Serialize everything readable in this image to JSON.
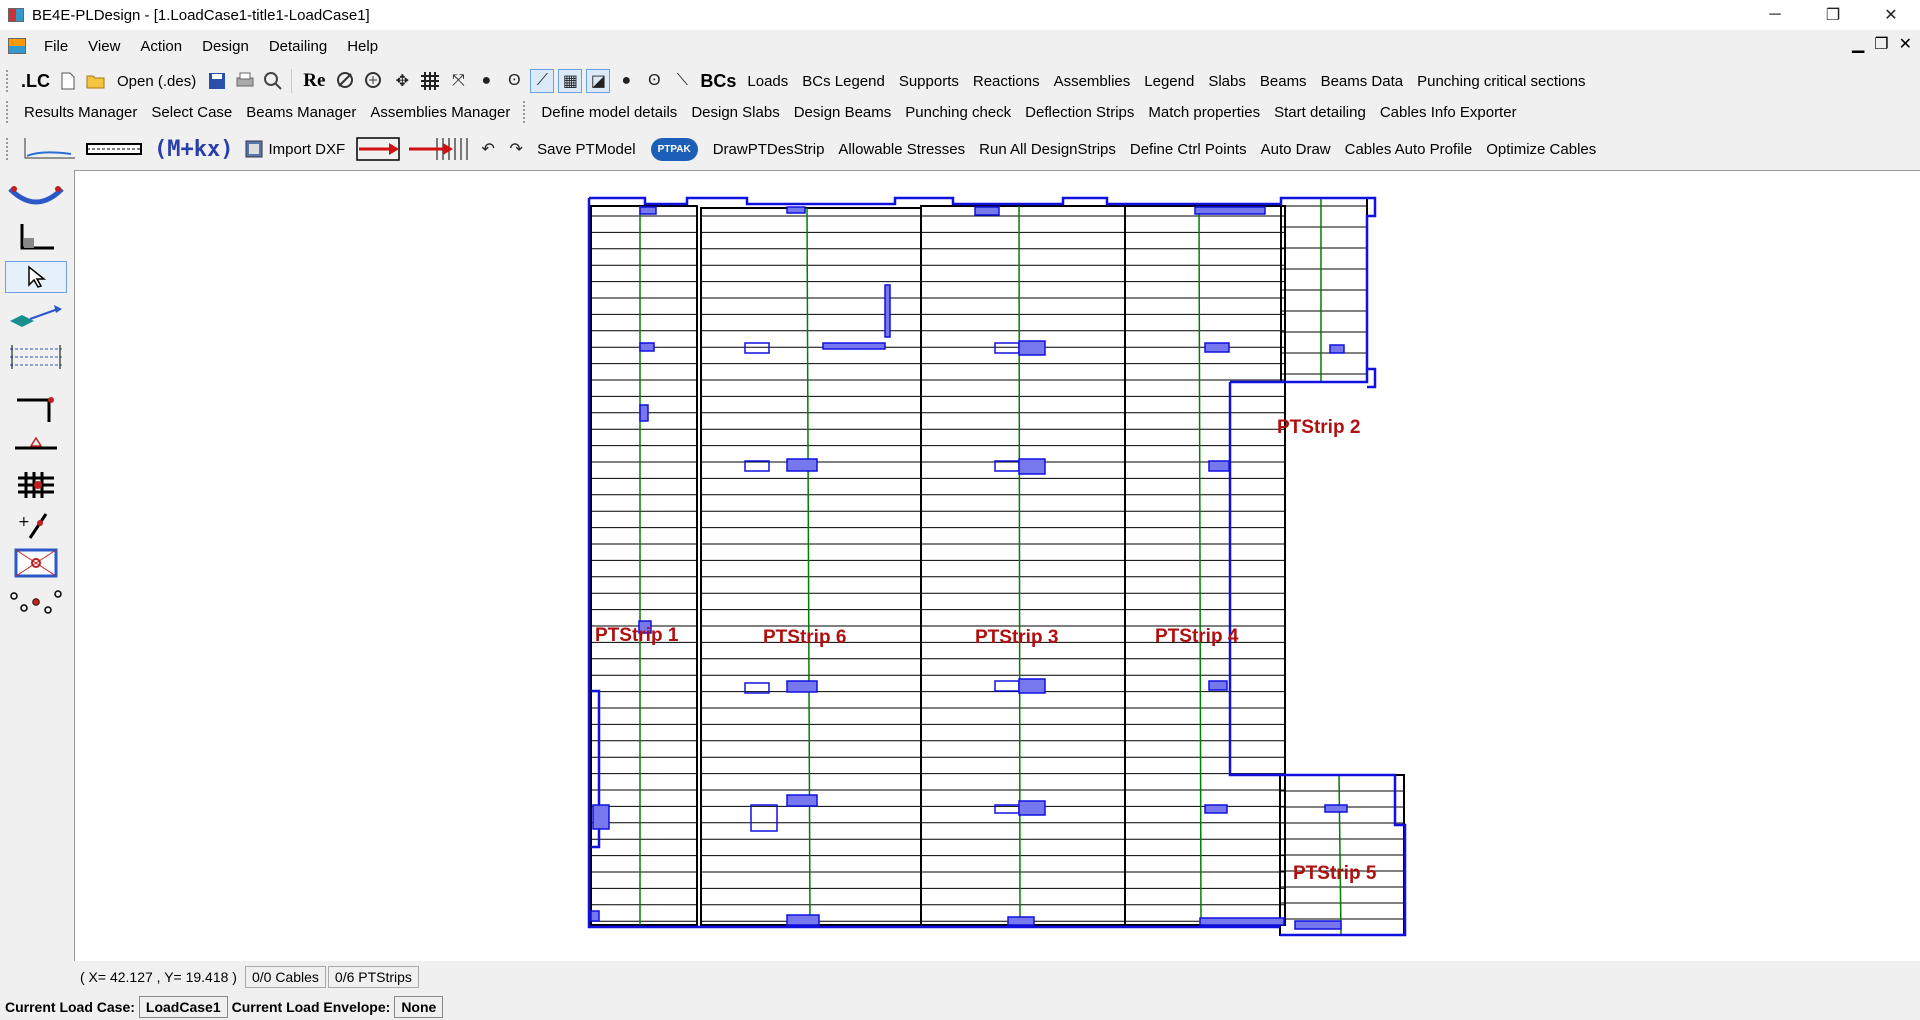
{
  "window": {
    "title": "BE4E-PLDesign - [1.LoadCase1-title1-LoadCase1]",
    "controls": {
      "minimize": "─",
      "restore": "❐",
      "close": "✕"
    }
  },
  "menu": {
    "items": [
      "File",
      "View",
      "Action",
      "Design",
      "Detailing",
      "Help"
    ],
    "mdi_controls": {
      "minimize": "▁",
      "restore": "❐",
      "close": "✕"
    }
  },
  "toolbar1": {
    "lc": ".LC",
    "open": "Open (.des)",
    "re": "Re",
    "bcs": "BCs",
    "buttons": [
      "Loads",
      "BCs Legend",
      "Supports",
      "Reactions",
      "Assemblies",
      "Legend",
      "Slabs",
      "Beams",
      "Beams Data",
      "Punching critical sections"
    ]
  },
  "toolbar2": {
    "buttons_a": [
      "Results Manager",
      "Select Case",
      "Beams Manager",
      "Assemblies Manager"
    ],
    "buttons_b": [
      "Define model details",
      "Design Slabs",
      "Design Beams",
      "Punching check",
      "Deflection Strips",
      "Match properties",
      "Start detailing",
      "Cables Info Exporter"
    ]
  },
  "toolbar3": {
    "formula": "(M+kx)",
    "import_dxf": "Import DXF",
    "save_ptmodel": "Save PTModel",
    "ptpak": "PTPAK",
    "buttons": [
      "DrawPTDesStrip",
      "Allowable Stresses",
      "Run All DesignStrips",
      "Define Ctrl Points",
      "Auto Draw",
      "Cables Auto Profile",
      "Optimize Cables"
    ]
  },
  "drawing": {
    "strip_labels": [
      "PTStrip 1",
      "PTStrip 6",
      "PTStrip 3",
      "PTStrip 4",
      "PTStrip 2",
      "PTStrip 5"
    ],
    "colors": {
      "outline": "#1010e0",
      "fill": "#7878ee",
      "slab_lines": "#000000",
      "strip_axis": "#008000",
      "label": "#b01010"
    }
  },
  "status": {
    "coords": "( X= 42.127 , Y= 19.418 )",
    "cables": "0/0 Cables",
    "ptstrips": "0/6 PTStrips"
  },
  "bottom": {
    "load_case_label": "Current Load Case:",
    "load_case_value": "LoadCase1",
    "envelope_label": "Current Load Envelope:",
    "envelope_value": "None"
  }
}
